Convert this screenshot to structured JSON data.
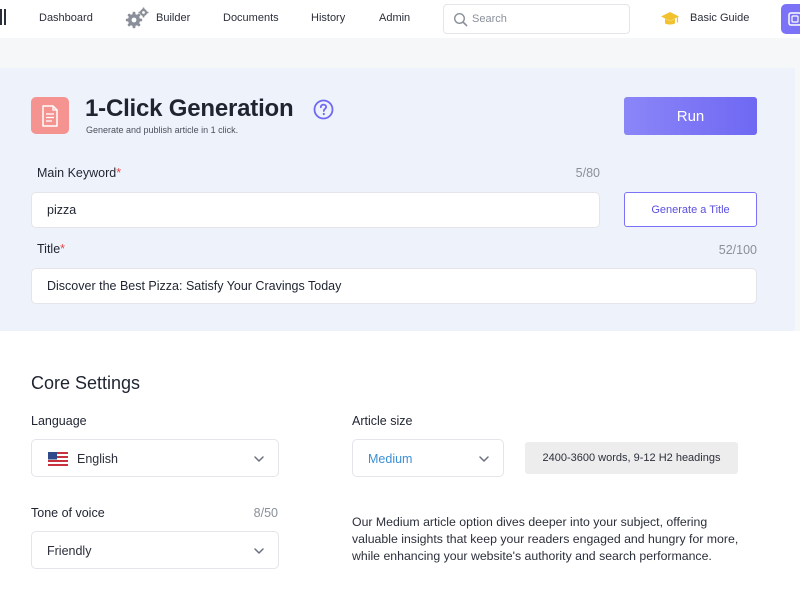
{
  "nav": {
    "items": [
      {
        "key": "dashboard",
        "label": "Dashboard"
      },
      {
        "key": "builder",
        "label": "Builder"
      },
      {
        "key": "documents",
        "label": "Documents"
      },
      {
        "key": "history",
        "label": "History"
      },
      {
        "key": "admin",
        "label": "Admin"
      }
    ],
    "search": {
      "placeholder": "Search",
      "value": ""
    },
    "guide_label": "Basic Guide"
  },
  "generation": {
    "title": "1-Click Generation",
    "subtitle": "Generate and publish article in 1 click.",
    "run_label": "Run",
    "main_keyword": {
      "label": "Main Keyword",
      "required_mark": "*",
      "counter": "5/80",
      "value": "pizza"
    },
    "generate_title_label": "Generate a Title",
    "title_field": {
      "label": "Title",
      "required_mark": "*",
      "counter": "52/100",
      "value": "Discover the Best Pizza: Satisfy Your Cravings Today"
    }
  },
  "core_settings": {
    "title": "Core Settings",
    "language": {
      "label": "Language",
      "value": "English"
    },
    "tone": {
      "label": "Tone of voice",
      "counter": "8/50",
      "value": "Friendly"
    },
    "article_size": {
      "label": "Article size",
      "value": "Medium",
      "badge": "2400-3600 words, 9-12 H2 headings"
    },
    "description": "Our Medium article option dives deeper into your subject, offering valuable insights that keep your readers engaged and hungry for more, while enhancing your website's authority and search performance."
  },
  "colors": {
    "accent": "#7c72f7",
    "run_gradient_start": "#8b86f8",
    "run_gradient_end": "#6f68f3",
    "doc_icon_bg": "#f4938f",
    "required": "#e5484d",
    "selected_link": "#3b8fd6",
    "guide_icon": "#f2c12e"
  },
  "icons": {
    "builder": "gear-icon",
    "search": "search-icon",
    "guide": "graduation-cap-icon",
    "generation": "document-icon",
    "help": "question-circle-icon",
    "select": "chevron-down-icon",
    "language": "us-flag-icon"
  }
}
